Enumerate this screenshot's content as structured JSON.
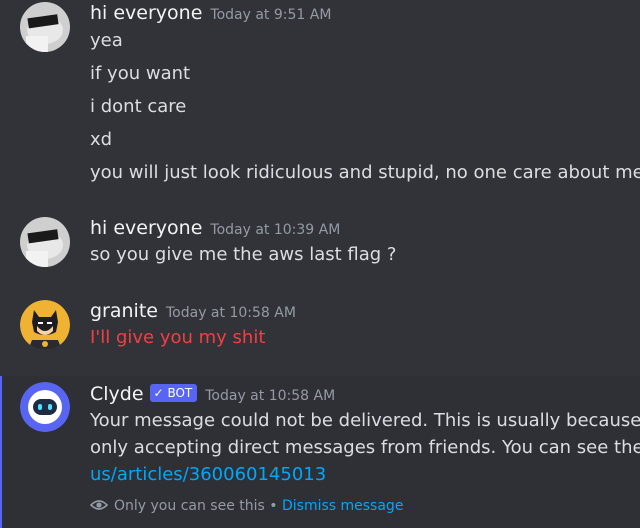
{
  "messages": [
    {
      "author": "hi everyone",
      "timestamp": "Today at 9:51 AM",
      "lines": [
        "yea",
        "if you want",
        "i dont care",
        "xd",
        "you will just look ridiculous and stupid, no one care about me"
      ]
    },
    {
      "author": "hi everyone",
      "timestamp": "Today at 10:39 AM",
      "lines": [
        "so you give me the aws last flag ?"
      ]
    },
    {
      "author": "granite",
      "timestamp": "Today at 10:58 AM",
      "lines": [
        "I'll give you my shit"
      ]
    }
  ],
  "clyde": {
    "author": "Clyde",
    "badge": "BOT",
    "timestamp": "Today at 10:58 AM",
    "line1": "Your message could not be delivered. This is usually because yo",
    "line2": "only accepting direct messages from friends. You can see the fu",
    "link": "us/articles/360060145013",
    "ephemeral_note": "Only you can see this",
    "separator": "•",
    "dismiss": "Dismiss message"
  },
  "colors": {
    "background": "#313338",
    "red_text": "#f23f43",
    "link": "#00a8fc",
    "bot_badge": "#5865f2",
    "granite_avatar": "#f0b232"
  },
  "icons": {
    "avatar1": "photo-avatar-icon",
    "granite": "batman-avatar-icon",
    "clyde": "clyde-robot-icon",
    "check": "check-icon",
    "eye": "eye-icon"
  }
}
